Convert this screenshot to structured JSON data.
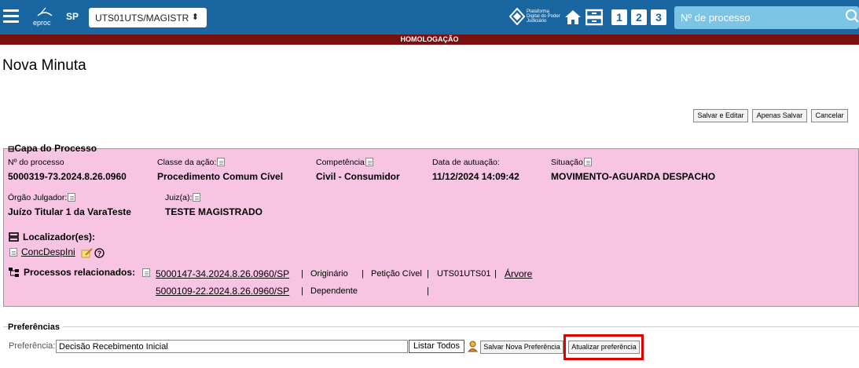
{
  "header": {
    "logo_text": "eproc",
    "state": "SP",
    "unit_select": "UTS01UTS/MAGISTR",
    "pdpj_text": "Plataforma Digital do Poder Judiciário",
    "quick_buttons": [
      "1",
      "2",
      "3"
    ],
    "search_placeholder": "Nº de processo",
    "env_banner": "HOMOLOGAÇÃO"
  },
  "page": {
    "title": "Nova Minuta"
  },
  "actions": {
    "save_edit": "Salvar e Editar",
    "save_only": "Apenas Salvar",
    "cancel": "Cancelar"
  },
  "capa": {
    "legend": "Capa do Processo",
    "numero_label": "Nº do processo",
    "numero_value": "5000319-73.2024.8.26.0960",
    "classe_label": "Classe da ação:",
    "classe_value": "Procedimento Comum Cível",
    "competencia_label": "Competência",
    "competencia_value": "Civil - Consumidor",
    "data_label": "Data de autuação:",
    "data_value": "11/12/2024 14:09:42",
    "situacao_label": "Situação",
    "situacao_value": "MOVIMENTO-AGUARDA DESPACHO",
    "orgao_label": "Órgão Julgador:",
    "orgao_value": "Juízo Titular 1 da VaraTeste",
    "juiz_label": "Juiz(a):",
    "juiz_value": "TESTE MAGISTRADO",
    "localizadores_label": "Localizador(es):",
    "localizador_link": "ConcDespIni",
    "relacionados_label": "Processos relacionados:",
    "relacionados": [
      {
        "numero": "5000147-34.2024.8.26.0960/SP",
        "tipo": "Originário",
        "classe": "Petição Cível",
        "unidade": "UTS01UTS01",
        "arvore": "Árvore"
      },
      {
        "numero": "5000109-22.2024.8.26.0960/SP",
        "tipo": "Dependente"
      }
    ]
  },
  "preferencias": {
    "title": "Preferências",
    "label": "Preferência:",
    "value": "Decisão Recebimento Inicial",
    "listar_todos": "Listar Todos",
    "salvar_nova": "Salvar Nova Preferência",
    "atualizar": "Atualizar preferência"
  },
  "colors": {
    "topbar": "#1a66a0",
    "banner": "#7a0f0f",
    "capa_bg": "#f7c4e2",
    "highlight": "#e00000"
  }
}
